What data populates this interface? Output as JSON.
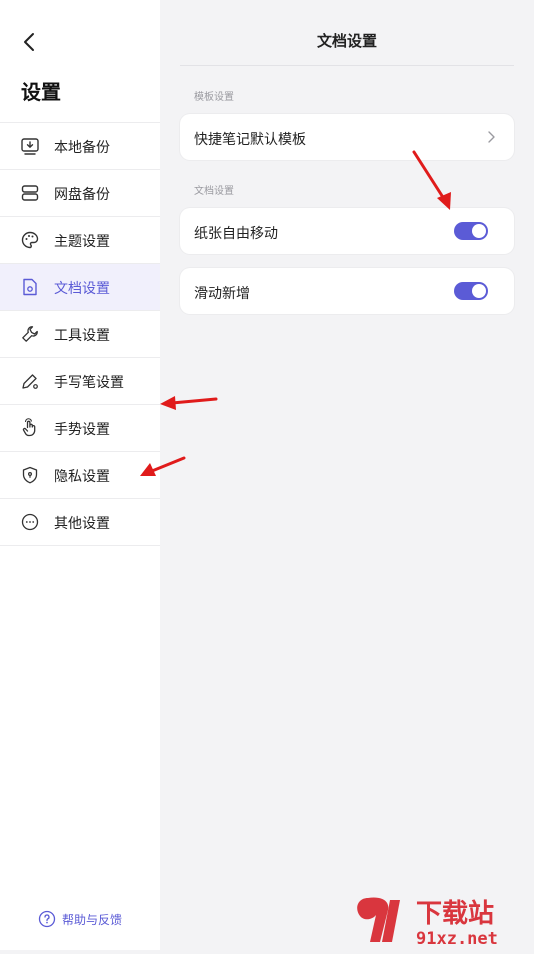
{
  "sidebar": {
    "title": "设置",
    "items": [
      {
        "label": "本地备份",
        "icon": "local-backup-icon"
      },
      {
        "label": "网盘备份",
        "icon": "cloud-drive-icon"
      },
      {
        "label": "主题设置",
        "icon": "palette-icon"
      },
      {
        "label": "文档设置",
        "icon": "document-settings-icon",
        "active": true
      },
      {
        "label": "工具设置",
        "icon": "wrench-icon"
      },
      {
        "label": "手写笔设置",
        "icon": "pen-icon"
      },
      {
        "label": "手势设置",
        "icon": "gesture-hand-icon"
      },
      {
        "label": "隐私设置",
        "icon": "shield-icon"
      },
      {
        "label": "其他设置",
        "icon": "more-icon"
      }
    ],
    "help_label": "帮助与反馈"
  },
  "main": {
    "title": "文档设置",
    "template_section_label": "模板设置",
    "quick_note_template_label": "快捷笔记默认模板",
    "document_section_label": "文档设置",
    "paper_free_move_label": "纸张自由移动",
    "paper_free_move_on": true,
    "slide_add_label": "滑动新增",
    "slide_add_on": true
  },
  "watermark": {
    "text_cn": "下载站",
    "text_en": "91xz.net"
  },
  "colors": {
    "accent": "#5b5bd6",
    "arrow": "#e01b1b",
    "watermark": "#d9363e"
  }
}
